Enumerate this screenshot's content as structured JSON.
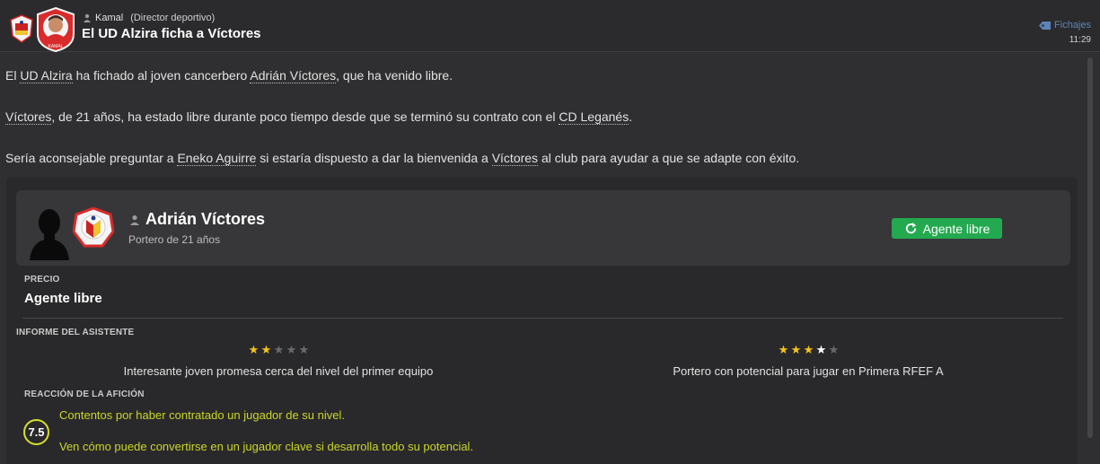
{
  "header": {
    "sender_name": "Kamal",
    "sender_role": "(Director deportivo)",
    "headline": "El UD Alzira ficha a Víctores",
    "category": "Fichajes",
    "time": "11:29",
    "avatar_badge_text": "KAMAL"
  },
  "paragraphs": {
    "p1": {
      "t1": "El ",
      "club": "UD Alzira",
      "t2": " ha fichado al joven cancerbero ",
      "player": "Adrián Víctores",
      "t3": ", que ha venido libre."
    },
    "p2": {
      "player": "Víctores",
      "t1": ", de 21 años, ha estado libre durante poco tiempo desde que se terminó su contrato con el ",
      "club": "CD Leganés",
      "t2": "."
    },
    "p3": {
      "t1": "Sería aconsejable preguntar a ",
      "person": "Eneko Aguirre",
      "t2": " si estaría dispuesto a dar la bienvenida a ",
      "player": "Víctores",
      "t3": " al club para ayudar a que se adapte con éxito."
    }
  },
  "player_card": {
    "name": "Adrián Víctores",
    "subtitle": "Portero de 21 años",
    "status_button": "Agente libre"
  },
  "price": {
    "label": "PRECIO",
    "value": "Agente libre"
  },
  "assistant_report": {
    "label": "INFORME DEL ASISTENTE",
    "current": {
      "stars": 2,
      "max": 5,
      "text": "Interesante joven promesa cerca del nivel del primer equipo"
    },
    "potential": {
      "stars": 3.5,
      "max": 5,
      "text": "Portero con potencial para jugar en Primera RFEF A"
    }
  },
  "fan_reaction": {
    "label": "REACCIÓN DE LA AFICIÓN",
    "rating": "7.5",
    "line1": "Contentos por haber contratado un jugador de su nivel.",
    "line2": "Ven cómo puede convertirse en un jugador clave si desarrolla todo su potencial."
  },
  "colors": {
    "accent_green": "#23a94f",
    "fan_yellow": "#cbd62a",
    "star_gold": "#f5c518",
    "category_blue": "#5c84b8"
  }
}
